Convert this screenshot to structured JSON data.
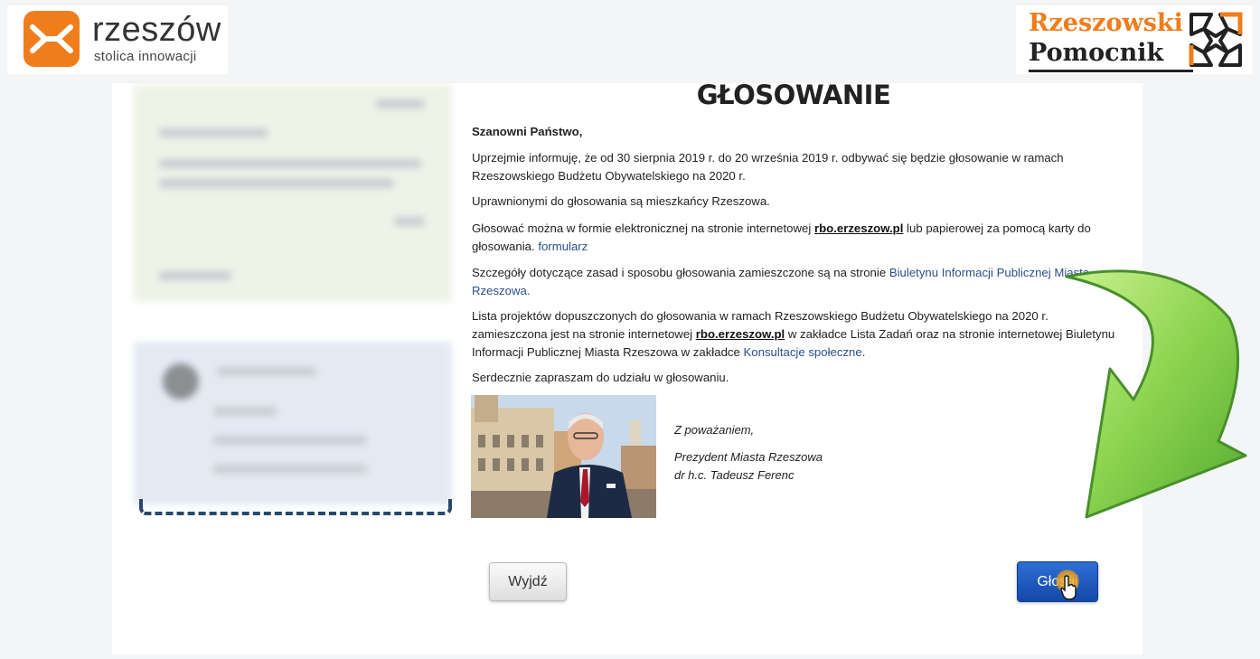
{
  "logos": {
    "left_word": "rzeszów",
    "left_tagline": "stolica innowacji",
    "right_line1": "Rzeszowski",
    "right_line2": "Pomocnik"
  },
  "page": {
    "title": "GŁOSOWANIE",
    "greeting": "Szanowni Państwo,",
    "p1": "Uprzejmie informuję, że od 30 sierpnia 2019 r. do 20 września 2019 r. odbywać się będzie głosowanie w ramach Rzeszowskiego Budżetu Obywatelskiego na 2020 r.",
    "p2": "Uprawnionymi do głosowania są mieszkańcy Rzeszowa.",
    "p3_before": "Głosować można w formie elektronicznej na stronie internetowej ",
    "p3_link": "rbo.erzeszow.pl",
    "p3_middle": " lub papierowej za pomocą karty do głosowania. ",
    "p3_form_link": "formularz",
    "p4_before": "Szczegóły dotyczące zasad i sposobu głosowania zamieszczone są na stronie ",
    "p4_link": "Biuletynu Informacji Publicznej Miasta Rzeszowa.",
    "p5_before": "Lista projektów dopuszczonych do głosowania w ramach Rzeszowskiego Budżetu Obywatelskiego na 2020 r. zamieszczona jest na stronie internetowej ",
    "p5_link": "rbo.erzeszow.pl",
    "p5_middle": " w zakładce Lista Zadań oraz na stronie internetowej Biuletynu Informacji Publicznej Miasta Rzeszowa w zakładce ",
    "p5_link2": "Konsultacje społeczne",
    "p5_end": ".",
    "p6": "Serdecznie zapraszam do udziału w głosowaniu.",
    "sig1": "Z poważaniem,",
    "sig2": "Prezydent Miasta Rzeszowa",
    "sig3": "dr h.c. Tadeusz Ferenc"
  },
  "buttons": {
    "exit": "Wyjdź",
    "vote": "Głosuj"
  },
  "colors": {
    "brand_orange": "#f07d1c",
    "vote_blue": "#1f5bc2",
    "link_blue": "#2a4f8a",
    "arrow_green": "#7ccd3a"
  },
  "icons": [
    "rzeszow-logo-icon",
    "pomocnik-logo-icon",
    "green-arrow-icon",
    "hand-cursor-icon"
  ]
}
